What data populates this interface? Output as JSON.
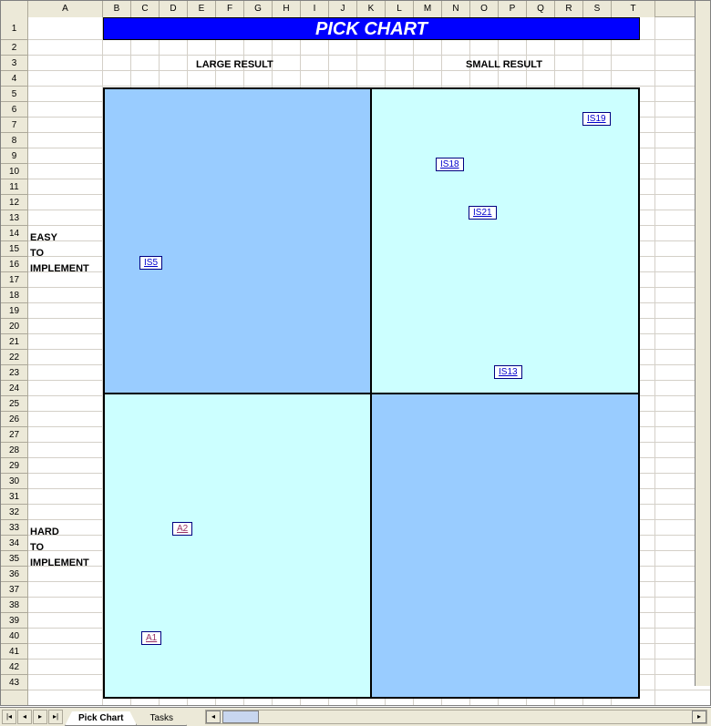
{
  "title": "PICK CHART",
  "headers": {
    "large": "LARGE RESULT",
    "small": "SMALL RESULT"
  },
  "ylabels": {
    "easy": [
      "EASY",
      "TO",
      "IMPLEMENT"
    ],
    "hard": [
      "HARD",
      "TO",
      "IMPLEMENT"
    ]
  },
  "chips": {
    "is5": "IS5",
    "is18": "IS18",
    "is19": "IS19",
    "is21": "IS21",
    "is13": "IS13",
    "a1": "A1",
    "a2": "A2"
  },
  "tabs": {
    "active": "Pick Chart",
    "other": "Tasks"
  },
  "nav": {
    "first": "|◂",
    "prev": "◂",
    "next": "▸",
    "last": "▸|"
  },
  "scroll": {
    "left": "◂",
    "right": "▸"
  },
  "columns": [
    "A",
    "B",
    "C",
    "D",
    "E",
    "F",
    "G",
    "H",
    "I",
    "J",
    "K",
    "L",
    "M",
    "N",
    "O",
    "P",
    "Q",
    "R",
    "S",
    "T"
  ],
  "colWidths": {
    "A": 82,
    "default": 31,
    "T": 48
  },
  "rowCount": 43,
  "tallRow": 1,
  "chart_data": {
    "type": "table",
    "title": "PICK CHART",
    "x_axis": [
      "LARGE RESULT",
      "SMALL RESULT"
    ],
    "y_axis": [
      "EASY TO IMPLEMENT",
      "HARD TO IMPLEMENT"
    ],
    "quadrants": [
      {
        "x": "LARGE RESULT",
        "y": "EASY TO IMPLEMENT",
        "fill": "#99ccff",
        "items": [
          "IS5"
        ]
      },
      {
        "x": "SMALL RESULT",
        "y": "EASY TO IMPLEMENT",
        "fill": "#ccffff",
        "items": [
          "IS19",
          "IS18",
          "IS21",
          "IS13"
        ]
      },
      {
        "x": "LARGE RESULT",
        "y": "HARD TO IMPLEMENT",
        "fill": "#ccffff",
        "items": [
          "A2",
          "A1"
        ]
      },
      {
        "x": "SMALL RESULT",
        "y": "HARD TO IMPLEMENT",
        "fill": "#99ccff",
        "items": []
      }
    ]
  }
}
